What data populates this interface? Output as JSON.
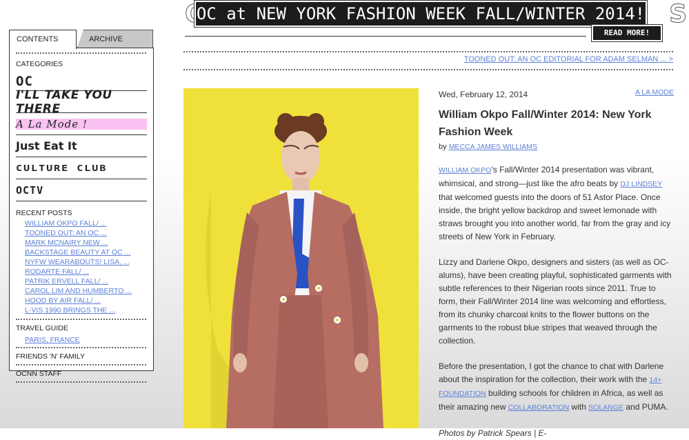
{
  "banner": {
    "bg_text_left": "OC",
    "bg_text_right": "S",
    "headline": "OC at NEW YORK FASHION WEEK FALL/WINTER 2014!",
    "read_more": "READ MORE!"
  },
  "nav": {
    "prev_post": "TOONED OUT: AN OC EDITORIAL FOR ADAM SELMAN ... >"
  },
  "sidebar": {
    "tabs": [
      "CONTENTS",
      "ARCHIVE"
    ],
    "categories_heading": "CATEGORIES",
    "categories": [
      "OC",
      "I'LL TAKE YOU THERE",
      "A La Mode !",
      "Just Eat It",
      "CULTURE CLUB",
      "OCTV"
    ],
    "recent_heading": "RECENT POSTS",
    "recent_posts": [
      "WILLIAM OKPO FALL/ ...",
      "TOONED OUT: AN OC ...",
      "MARK MCNAIRY NEW ...",
      "BACKSTAGE BEAUTY AT OC ...",
      "NYFW WEARABOUTS! LISA, ...",
      "RODARTE FALL/ ...",
      "PATRIK ERVELL FALL/ ...",
      "CAROL LIM AND HUMBERTO ...",
      "HOOD BY AIR FALL/ ...",
      "L-VIS 1990 BRINGS THE ..."
    ],
    "travel_heading": "TRAVEL GUIDE",
    "travel_item": "PARIS, FRANCE",
    "friends": "FRIENDS 'N' FAMILY",
    "staff": "OCNN STAFF"
  },
  "post": {
    "date": "Wed, February 12, 2014",
    "category": "A LA MODE",
    "title": "William Okpo Fall/Winter 2014: New York Fashion Week",
    "by": "by",
    "author": "MECCA JAMES WILLIAMS",
    "p1": {
      "link1": "WILLIAM OKPO",
      "t1": "'s Fall/Winter 2014 presentation was vibrant, whimsical, and strong—just like the afro beats by ",
      "link2": "DJ LINDSEY",
      "t2": " that welcomed guests into the doors of 51 Astor Place. Once inside, the bright yellow backdrop and sweet lemonade with straws brought you into another world, far from the gray and icy streets of New York in February."
    },
    "p2": "Lizzy and Darlene Okpo, designers and sisters (as well as OC-alums), have been creating playful, sophisticated garments with subtle references to their Nigerian roots since 2011. True to form, their Fall/Winter 2014 line was welcoming and effortless, from its chunky charcoal knits to the flower buttons on the garments to the robust blue stripes that weaved through the collection.",
    "p3": {
      "t1": "Before the presentation, I got the chance to chat with Darlene about the inspiration for the collection, their work with the ",
      "link1": "14+ FOUNDATION",
      "t2": " building schools for children in Africa, as well as their amazing new ",
      "link2": "COLLABORATION",
      "t3": " with ",
      "link3": "SOLANGE",
      "t4": " and PUMA."
    },
    "credit": "Photos by Patrick Spears | E-"
  },
  "colors": {
    "backdrop": "#f0e13a",
    "coat": "#b66e62",
    "link": "#5b7fd6",
    "highlight": "#f9c2f2"
  }
}
